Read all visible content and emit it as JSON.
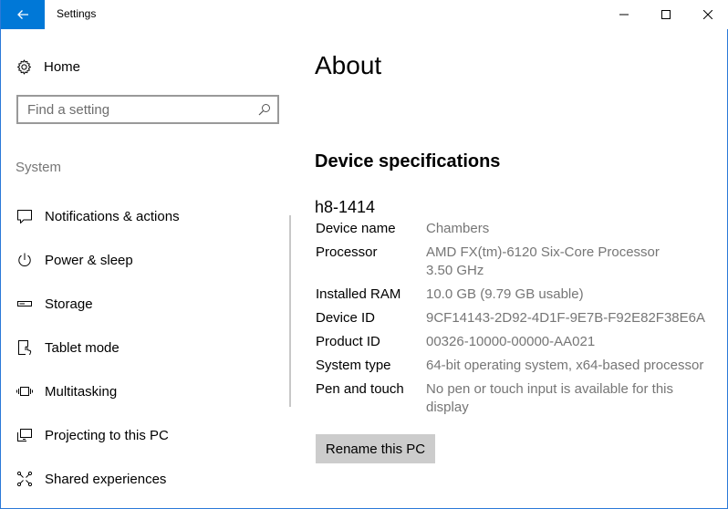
{
  "window": {
    "title": "Settings"
  },
  "sidebar": {
    "home_label": "Home",
    "search_placeholder": "Find a setting",
    "section_label": "System",
    "items": [
      {
        "label": "Notifications & actions",
        "icon": "notification-icon"
      },
      {
        "label": "Power & sleep",
        "icon": "power-icon"
      },
      {
        "label": "Storage",
        "icon": "storage-icon"
      },
      {
        "label": "Tablet mode",
        "icon": "tablet-mode-icon"
      },
      {
        "label": "Multitasking",
        "icon": "multitasking-icon"
      },
      {
        "label": "Projecting to this PC",
        "icon": "projecting-icon"
      },
      {
        "label": "Shared experiences",
        "icon": "shared-experiences-icon"
      }
    ]
  },
  "main": {
    "title": "About",
    "section_title": "Device specifications",
    "device_heading": "h8-1414",
    "specs": [
      {
        "key": "Device name",
        "value": "Chambers"
      },
      {
        "key": "Processor",
        "value": "AMD FX(tm)-6120 Six-Core Processor 3.50 GHz"
      },
      {
        "key": "Installed RAM",
        "value": "10.0 GB (9.79 GB usable)"
      },
      {
        "key": "Device ID",
        "value": "9CF14143-2D92-4D1F-9E7B-F92E82F38E6A"
      },
      {
        "key": "Product ID",
        "value": "00326-10000-00000-AA021"
      },
      {
        "key": "System type",
        "value": "64-bit operating system, x64-based processor"
      },
      {
        "key": "Pen and touch",
        "value": "No pen or touch input is available for this display"
      }
    ],
    "rename_button": "Rename this PC"
  },
  "colors": {
    "accent": "#0078d7",
    "secondary_text": "#767676",
    "button_bg": "#cccccc"
  }
}
